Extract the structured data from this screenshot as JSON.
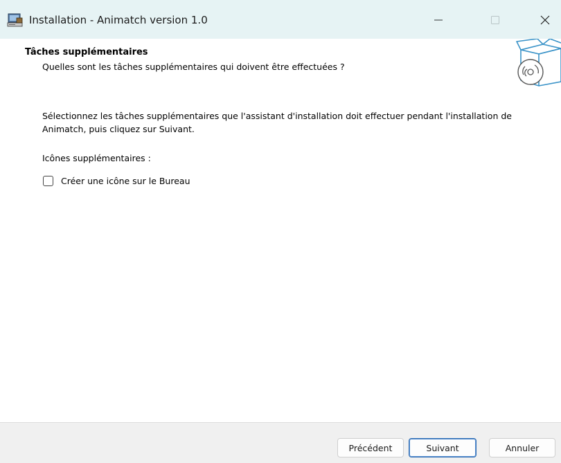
{
  "window": {
    "title": "Installation - Animatch version 1.0",
    "app_icon": "installer-computer-icon",
    "controls": {
      "minimize_icon": "minimize-icon",
      "maximize_icon": "maximize-icon",
      "close_icon": "close-icon"
    }
  },
  "header": {
    "title": "Tâches supplémentaires",
    "subtitle": "Quelles sont les tâches supplémentaires qui doivent être effectuées ?",
    "logo_icon": "software-box-disc-icon"
  },
  "body": {
    "description": "Sélectionnez les tâches supplémentaires que l'assistant d'installation doit effectuer pendant l'installation de Animatch, puis cliquez sur Suivant.",
    "section_label": "Icônes supplémentaires :",
    "tasks": [
      {
        "label": "Créer une icône sur le Bureau",
        "checked": false
      }
    ]
  },
  "footer": {
    "back_label": "Précédent",
    "next_label": "Suivant",
    "cancel_label": "Annuler"
  },
  "colors": {
    "titlebar_bg": "#e6f3f4",
    "footer_bg": "#f0f0f0",
    "default_button_border": "#2f6db4",
    "logo_stroke": "#3a93c8"
  }
}
